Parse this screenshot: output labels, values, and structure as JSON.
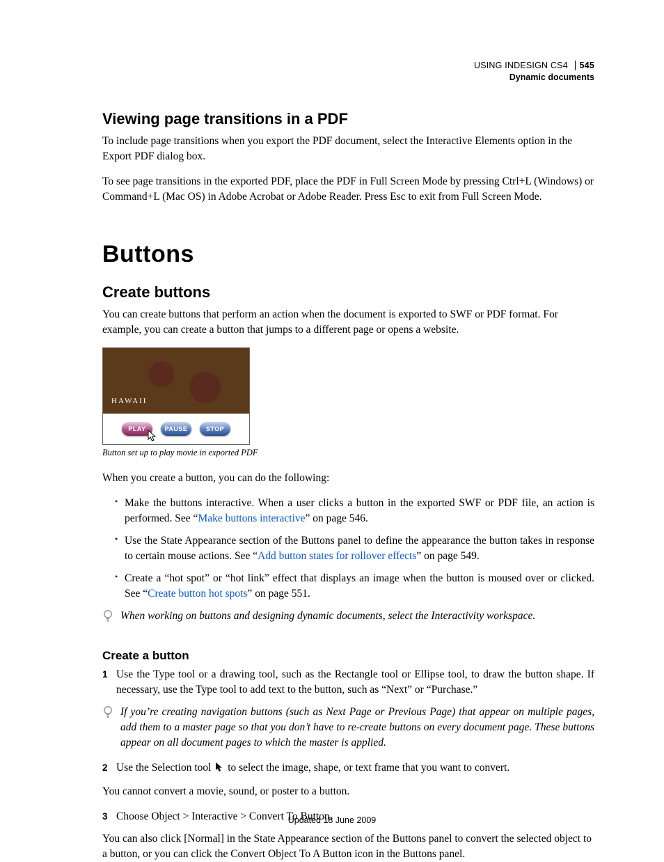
{
  "header": {
    "product": "USING INDESIGN CS4",
    "section": "Dynamic documents",
    "page_number": "545"
  },
  "h_viewing": "Viewing page transitions in a PDF",
  "p_viewing_1": "To include page transitions when you export the PDF document, select the Interactive Elements option in the Export PDF dialog box.",
  "p_viewing_2": "To see page transitions in the exported PDF, place the PDF in Full Screen Mode by pressing Ctrl+L (Windows) or Command+L (Mac OS) in Adobe Acrobat or Adobe Reader. Press Esc to exit from Full Screen Mode.",
  "chapter": "Buttons",
  "h_create": "Create buttons",
  "p_create_1": "You can create buttons that perform an action when the document is exported to SWF or PDF format. For example, you can create a button that jumps to a different page or opens a website.",
  "figure": {
    "hawaii": "HAWAII",
    "play": "PLAY",
    "pause": "PAUSE",
    "stop": "STOP",
    "caption": "Button set up to play movie in exported PDF"
  },
  "p_create_2": "When you create a button, you can do the following:",
  "bullets": {
    "b1a": "Make the buttons interactive. When a user clicks a button in the exported SWF or PDF file, an action is performed. See “",
    "b1_link": "Make buttons interactive",
    "b1b": "” on page 546.",
    "b2a": "Use the State Appearance section of the Buttons panel to define the appearance the button takes in response to certain mouse actions. See “",
    "b2_link": "Add button states for rollover effects",
    "b2b": "” on page 549.",
    "b3a": "Create a “hot spot” or “hot link” effect that displays an image when the button is moused over or clicked. See “",
    "b3_link": "Create button hot spots",
    "b3b": "” on page 551."
  },
  "tip1": "When working on buttons and designing dynamic documents, select the Interactivity workspace.",
  "h_createbtn": "Create a button",
  "steps": {
    "s1": "Use the Type tool or a drawing tool, such as the Rectangle tool or Ellipse tool, to draw the button shape. If necessary, use the Type tool to add text to the button, such as “Next” or “Purchase.”",
    "tip2": "If you’re creating navigation buttons (such as Next Page or Previous Page) that appear on multiple pages, add them to a master page so that you don’t have to re-create buttons on every document page. These buttons appear on all document pages to which the master is applied.",
    "s2a": "Use the Selection tool ",
    "s2b": " to select the image, shape, or text frame that you want to convert.",
    "p_after2": "You cannot convert a movie, sound, or poster to a button.",
    "s3": "Choose Object > Interactive > Convert To Button.",
    "p_after3": "You can also click [Normal] in the State Appearance section of the Buttons panel to convert the selected object to a button, or you can click the Convert Object To A Button icon in the Buttons panel."
  },
  "footer": "Updated 18 June 2009"
}
